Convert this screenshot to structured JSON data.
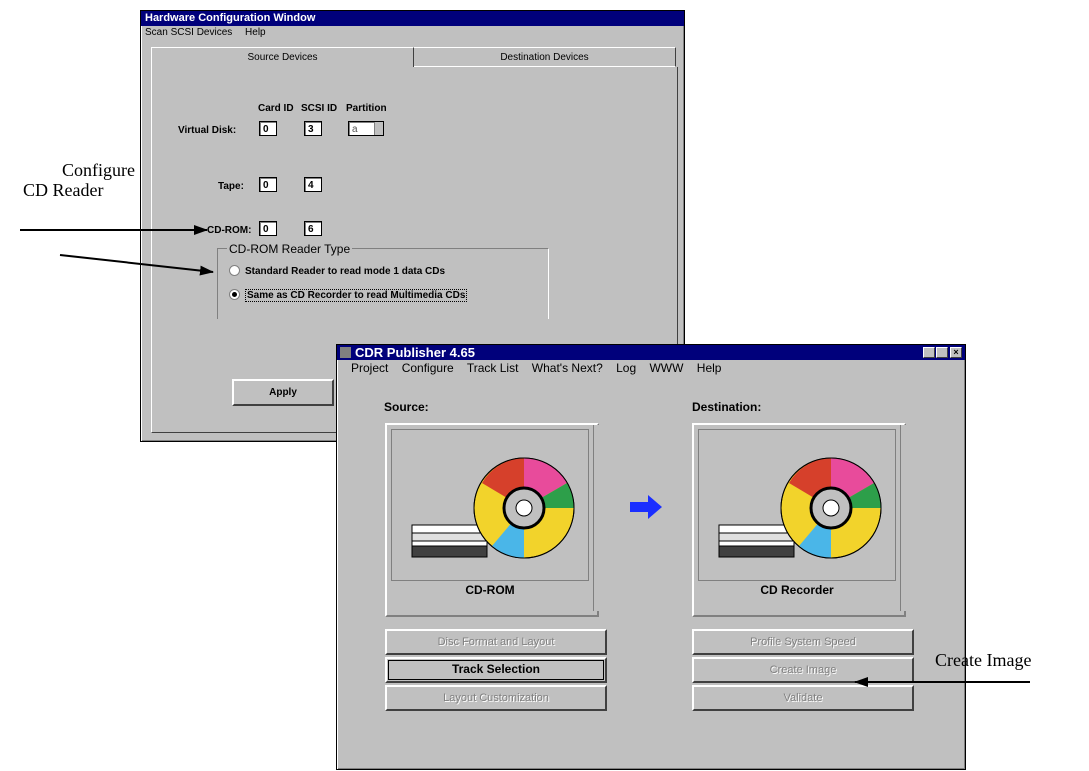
{
  "annotations": {
    "configure_line1": "Configure",
    "configure_line2": "CD Reader",
    "create_image": "Create Image"
  },
  "hw_window": {
    "title": "Hardware Configuration Window",
    "menu": [
      "Scan SCSI Devices",
      "Help"
    ],
    "tabs": [
      "Source Devices",
      "Destination Devices"
    ],
    "col_headers": [
      "Card ID",
      "SCSI ID",
      "Partition"
    ],
    "rows": [
      {
        "label": "Virtual Disk:",
        "card_id": "0",
        "scsi_id": "3",
        "partition": "a"
      },
      {
        "label": "Tape:",
        "card_id": "0",
        "scsi_id": "4"
      },
      {
        "label": "CD-ROM:",
        "card_id": "0",
        "scsi_id": "6"
      }
    ],
    "reader_group_title": "CD-ROM Reader Type",
    "reader_options": [
      {
        "label": "Standard Reader to read mode 1 data CDs",
        "selected": false
      },
      {
        "label": "Same as CD Recorder to read Multimedia CDs",
        "selected": true
      }
    ],
    "apply_label": "Apply"
  },
  "cdr_window": {
    "title": "CDR Publisher 4.65",
    "menu": [
      "Project",
      "Configure",
      "Track List",
      "What's Next?",
      "Log",
      "WWW",
      "Help"
    ],
    "source_label": "Source:",
    "destination_label": "Destination:",
    "source_device": "CD-ROM",
    "destination_device": "CD Recorder",
    "left_buttons": [
      {
        "label": "Disc Format and Layout",
        "enabled": false
      },
      {
        "label": "Track Selection",
        "enabled": true
      },
      {
        "label": "Layout Customization",
        "enabled": false
      }
    ],
    "right_buttons": [
      {
        "label": "Profile System Speed",
        "enabled": false
      },
      {
        "label": "Create Image",
        "enabled": false
      },
      {
        "label": "Validate",
        "enabled": false
      }
    ],
    "arrow_icon": "right-arrow-icon",
    "colors": {
      "titlebar": "#00007b",
      "arrow": "#1a2eff",
      "face": "#c0c0c0"
    }
  }
}
